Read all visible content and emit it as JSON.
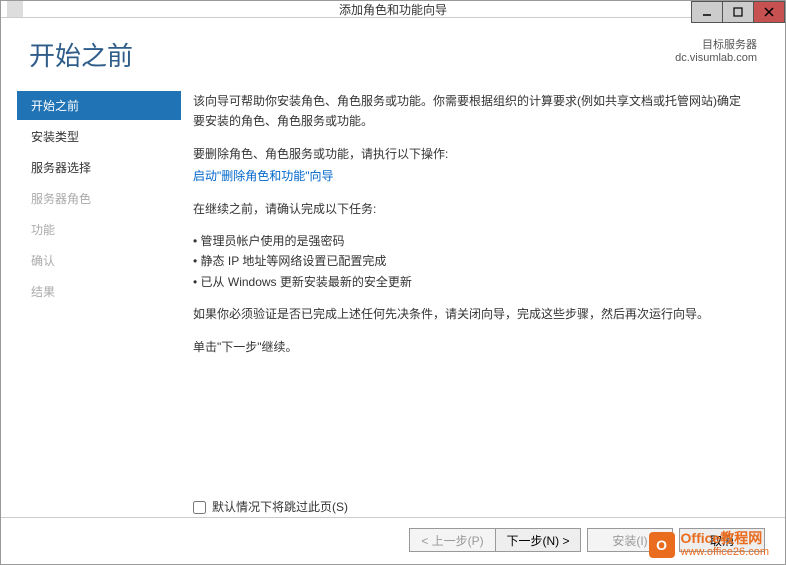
{
  "titlebar": {
    "title": "添加角色和功能向导"
  },
  "header": {
    "page_title": "开始之前",
    "target_label": "目标服务器",
    "target_server": "dc.visumlab.com"
  },
  "sidebar": {
    "items": [
      {
        "label": "开始之前",
        "state": "active"
      },
      {
        "label": "安装类型",
        "state": "normal"
      },
      {
        "label": "服务器选择",
        "state": "normal"
      },
      {
        "label": "服务器角色",
        "state": "disabled"
      },
      {
        "label": "功能",
        "state": "disabled"
      },
      {
        "label": "确认",
        "state": "disabled"
      },
      {
        "label": "结果",
        "state": "disabled"
      }
    ]
  },
  "main": {
    "p1": "该向导可帮助你安装角色、角色服务或功能。你需要根据组织的计算要求(例如共享文档或托管网站)确定要安装的角色、角色服务或功能。",
    "p2": "要删除角色、角色服务或功能，请执行以下操作:",
    "link": "启动\"删除角色和功能\"向导",
    "p3": "在继续之前，请确认完成以下任务:",
    "bullets": [
      "管理员帐户使用的是强密码",
      "静态 IP 地址等网络设置已配置完成",
      "已从 Windows 更新安装最新的安全更新"
    ],
    "p4": "如果你必须验证是否已完成上述任何先决条件，请关闭向导，完成这些步骤，然后再次运行向导。",
    "p5": "单击\"下一步\"继续。",
    "skip_label": "默认情况下将跳过此页(S)"
  },
  "footer": {
    "prev": "< 上一步(P)",
    "next": "下一步(N) >",
    "install": "安装(I)",
    "cancel": "取消"
  },
  "watermark": {
    "title": "Office教程网",
    "url": "www.office26.com"
  }
}
